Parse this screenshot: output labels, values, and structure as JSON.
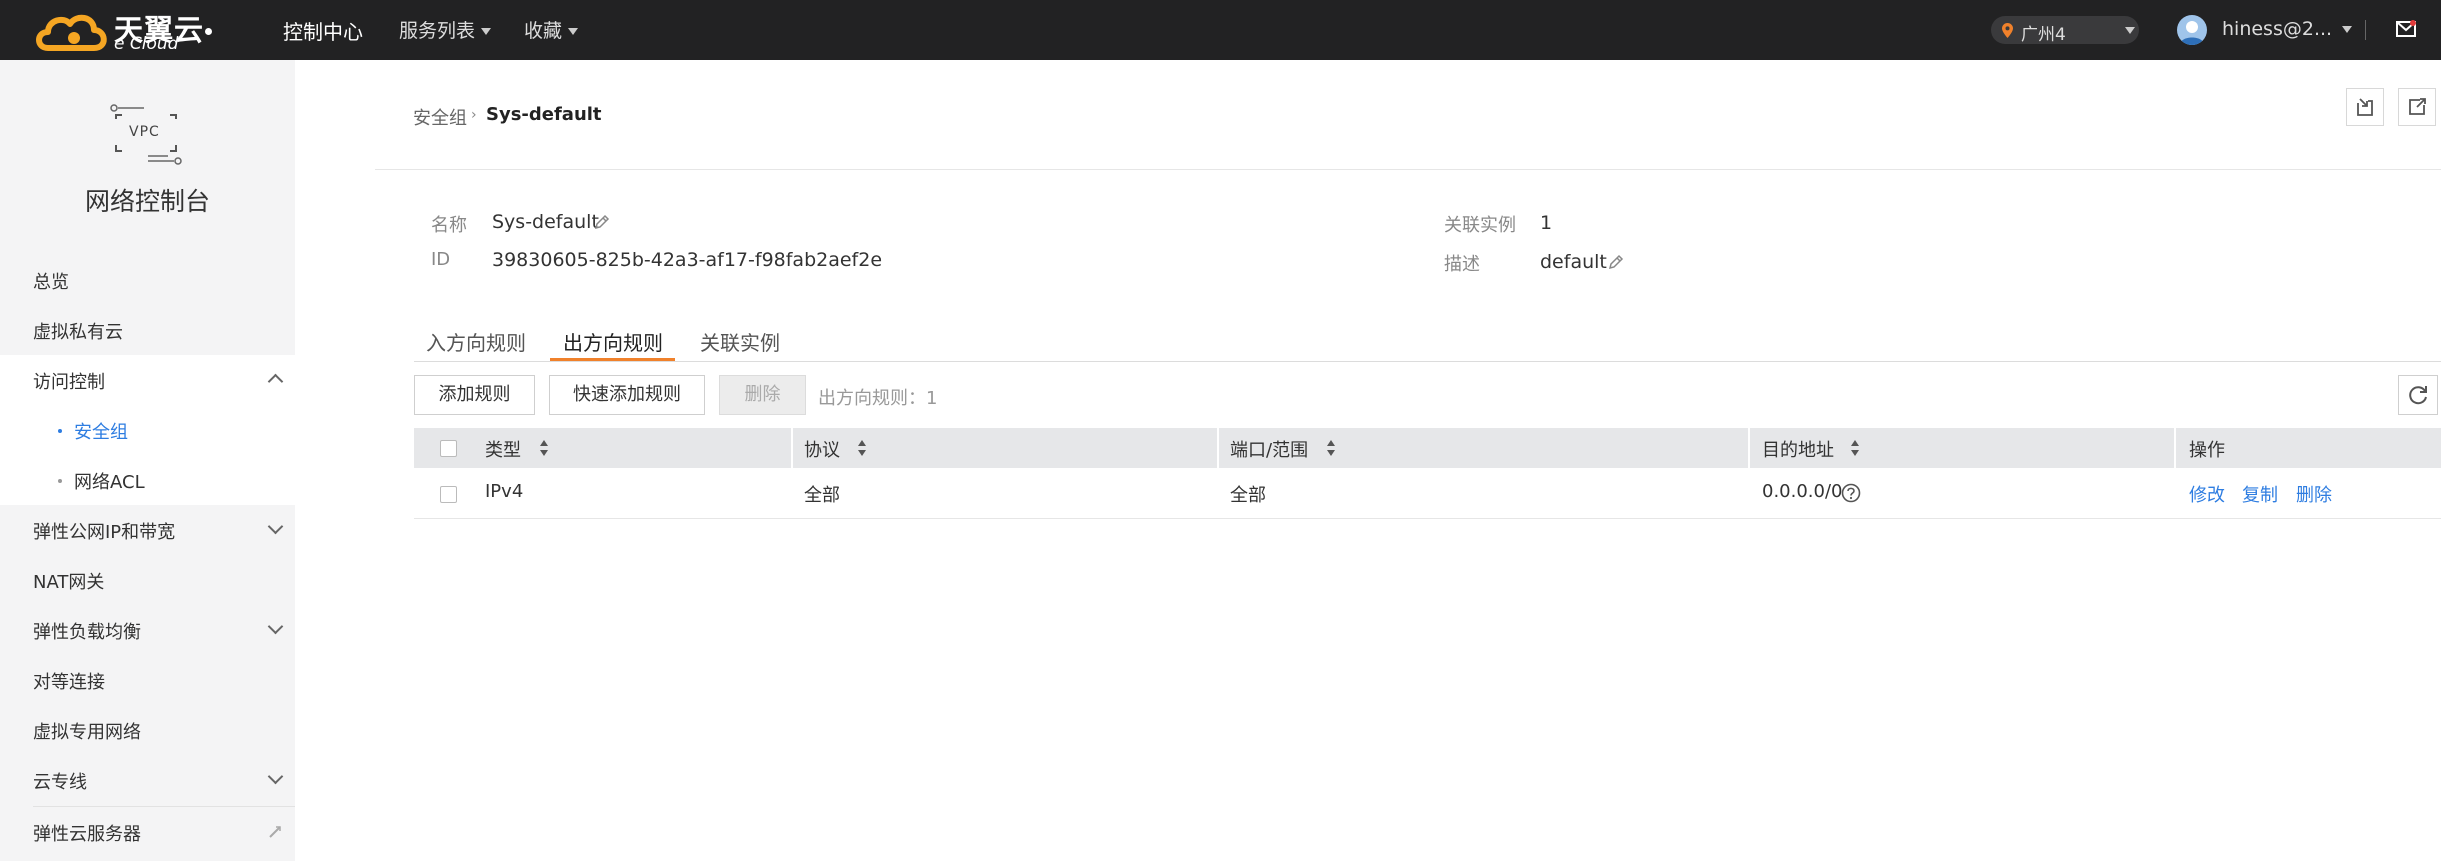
{
  "brand": {
    "name": "天翼云",
    "sub": "e Cloud"
  },
  "topnav": {
    "console": "控制中心",
    "services": "服务列表",
    "favorites": "收藏",
    "region": "广州4",
    "user": "hiness@2..."
  },
  "sidebar": {
    "badge": "VPC",
    "title": "网络控制台",
    "items": {
      "overview": "总览",
      "vpc": "虚拟私有云",
      "access": "访问控制",
      "security_group": "安全组",
      "acl": "网络ACL",
      "eip": "弹性公网IP和带宽",
      "nat": "NAT网关",
      "elb": "弹性负载均衡",
      "peering": "对等连接",
      "vpn": "虚拟专用网络",
      "dc": "云专线",
      "ecs": "弹性云服务器"
    }
  },
  "breadcrumb": {
    "parent": "安全组",
    "current": "Sys-default"
  },
  "detail": {
    "name_label": "名称",
    "name_value": "Sys-default",
    "id_label": "ID",
    "id_value": "39830605-825b-42a3-af17-f98fab2aef2e",
    "instances_label": "关联实例",
    "instances_value": "1",
    "desc_label": "描述",
    "desc_value": "default"
  },
  "tabs": {
    "inbound": "入方向规则",
    "outbound": "出方向规则",
    "instances": "关联实例"
  },
  "toolbar": {
    "add": "添加规则",
    "quick_add": "快速添加规则",
    "delete": "删除",
    "count_label": "出方向规则：",
    "count_value": "1"
  },
  "table": {
    "headers": {
      "type": "类型",
      "protocol": "协议",
      "port": "端口/范围",
      "dest": "目的地址",
      "actions": "操作"
    },
    "rows": [
      {
        "type": "IPv4",
        "protocol": "全部",
        "port": "全部",
        "dest": "0.0.0.0/0",
        "edit": "修改",
        "copy": "复制",
        "delete": "删除"
      }
    ]
  },
  "colors": {
    "topbar": "#222223",
    "accent_link": "#2e7de1",
    "tab_accent": "#f0812b",
    "sidebar_bg": "#f4f4f5"
  }
}
